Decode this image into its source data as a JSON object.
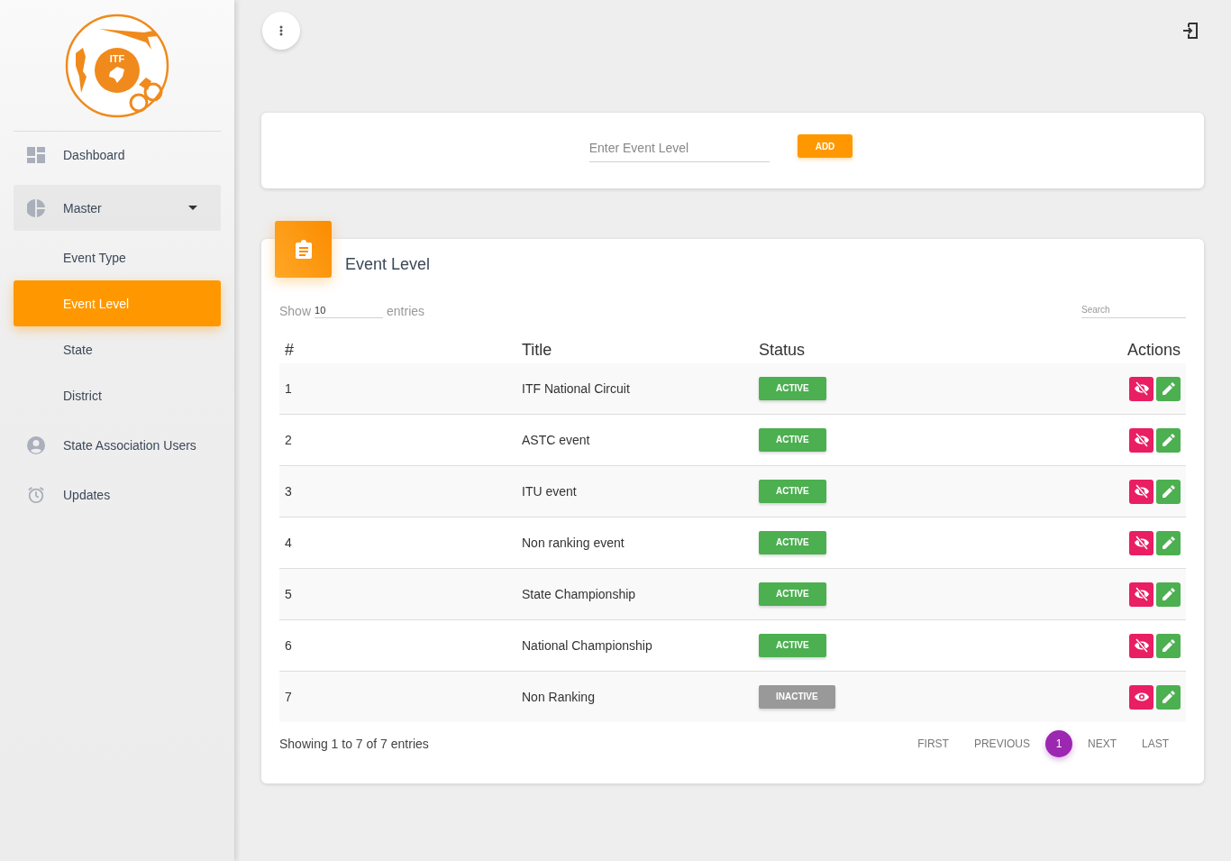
{
  "sidebar": {
    "logo_text": "ITF",
    "items": [
      {
        "label": "Dashboard",
        "selected": false
      },
      {
        "label": "Master",
        "selected": false,
        "expanded": true,
        "children": [
          {
            "label": "Event Type",
            "selected": false
          },
          {
            "label": "Event Level",
            "selected": true
          },
          {
            "label": "State",
            "selected": false
          },
          {
            "label": "District",
            "selected": false
          }
        ]
      },
      {
        "label": "State Association Users",
        "selected": false
      },
      {
        "label": "Updates",
        "selected": false
      }
    ]
  },
  "form": {
    "placeholder": "Enter Event Level",
    "button": "ADD"
  },
  "table_card": {
    "title": "Event Level",
    "show_label": "Show",
    "page_size": "10",
    "entries_label": "entries",
    "search": {
      "placeholder": "Search"
    },
    "columns": [
      "#",
      "Title",
      "Status",
      "Actions"
    ],
    "rows": [
      {
        "index": "1",
        "title": "ITF National Circuit",
        "status": "ACTIVE",
        "active": true
      },
      {
        "index": "2",
        "title": "ASTC event",
        "status": "ACTIVE",
        "active": true
      },
      {
        "index": "3",
        "title": "ITU event",
        "status": "ACTIVE",
        "active": true
      },
      {
        "index": "4",
        "title": "Non ranking event",
        "status": "ACTIVE",
        "active": true
      },
      {
        "index": "5",
        "title": "State Championship",
        "status": "ACTIVE",
        "active": true
      },
      {
        "index": "6",
        "title": "National Championship",
        "status": "ACTIVE",
        "active": true
      },
      {
        "index": "7",
        "title": "Non Ranking",
        "status": "INACTIVE",
        "active": false
      }
    ],
    "info": "Showing 1 to 7 of 7 entries",
    "pagination": {
      "first": "FIRST",
      "previous": "PREVIOUS",
      "pages": [
        {
          "label": "1",
          "selected": true
        }
      ],
      "next": "NEXT",
      "last": "LAST"
    }
  }
}
